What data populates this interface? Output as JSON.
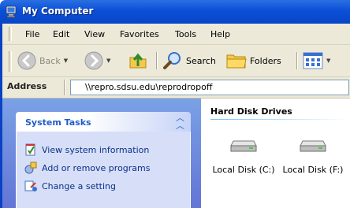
{
  "window": {
    "title": "My Computer",
    "title_icon": "my-computer-icon"
  },
  "menu": {
    "items": [
      {
        "label": "File"
      },
      {
        "label": "Edit"
      },
      {
        "label": "View"
      },
      {
        "label": "Favorites"
      },
      {
        "label": "Tools"
      },
      {
        "label": "Help"
      }
    ]
  },
  "toolbar": {
    "back_label": "Back",
    "search_label": "Search",
    "folders_label": "Folders"
  },
  "address": {
    "label": "Address",
    "value": "\\\\repro.sdsu.edu\\reprodropoff"
  },
  "tasks_panel": {
    "title": "System Tasks",
    "items": [
      {
        "label": "View system information",
        "icon": "system-info-icon"
      },
      {
        "label": "Add or remove programs",
        "icon": "add-remove-programs-icon"
      },
      {
        "label": "Change a setting",
        "icon": "change-setting-icon"
      }
    ]
  },
  "drives": {
    "group_title": "Hard Disk Drives",
    "items": [
      {
        "label": "Local Disk (C:)"
      },
      {
        "label": "Local Disk (F:)"
      }
    ]
  },
  "colors": {
    "titlebar": "#0b4fd8",
    "chrome": "#ece9d8",
    "task_pane": "#6375d6",
    "task_link": "#0c2f8a",
    "panel_title": "#215dc6"
  }
}
